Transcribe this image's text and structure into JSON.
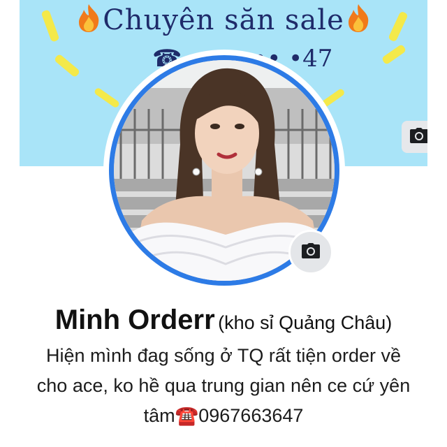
{
  "cover": {
    "title": "Chuyên săn sale",
    "phone_partial": "☎  •••• •• •47",
    "colors": {
      "background": "#a9e4f8",
      "text": "#1f2b6a",
      "accent": "#f4e94a"
    }
  },
  "profile": {
    "name": "Minh Orderr",
    "alternate_name": "(kho sỉ Quảng Châu)",
    "bio_line1": "Hiện mình đag sống ở TQ rất tiện order về",
    "bio_line2": "cho ace, ko hề qua trung gian nên ce cứ yên",
    "bio_line3_text": "tâm",
    "bio_phone_icon": "☎️",
    "bio_phone": "0967663647",
    "ring_color": "#2d7be6"
  },
  "icons": {
    "cover_camera": "camera-icon",
    "avatar_camera": "camera-icon",
    "flame": "fire-icon",
    "phone": "telephone-icon"
  }
}
